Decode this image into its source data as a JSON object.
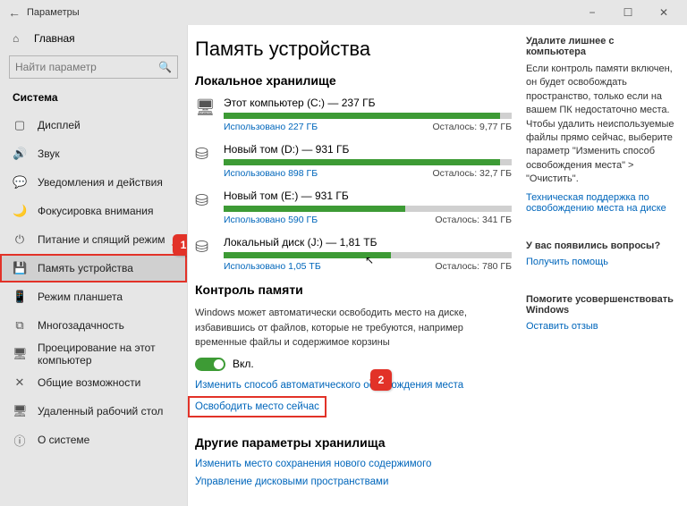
{
  "window": {
    "title": "Параметры"
  },
  "sidebar": {
    "home_label": "Главная",
    "search_placeholder": "Найти параметр",
    "group_label": "Система",
    "items": [
      {
        "icon": "▢",
        "label": "Дисплей"
      },
      {
        "icon": "🔊",
        "label": "Звук"
      },
      {
        "icon": "💬",
        "label": "Уведомления и действия"
      },
      {
        "icon": "🌙",
        "label": "Фокусировка внимания"
      },
      {
        "icon": "⏻",
        "label": "Питание и спящий режим"
      },
      {
        "icon": "💾",
        "label": "Память устройства"
      },
      {
        "icon": "📱",
        "label": "Режим планшета"
      },
      {
        "icon": "⧉",
        "label": "Многозадачность"
      },
      {
        "icon": "🖥",
        "label": "Проецирование на этот компьютер"
      },
      {
        "icon": "✕",
        "label": "Общие возможности"
      },
      {
        "icon": "🖥",
        "label": "Удаленный рабочий стол"
      },
      {
        "icon": "ⓘ",
        "label": "О системе"
      }
    ],
    "selected_index": 5
  },
  "annotations": {
    "badge1": "1",
    "badge2": "2"
  },
  "page": {
    "title": "Память устройства",
    "local_storage_header": "Локальное хранилище",
    "drives": [
      {
        "name": "Этот компьютер (C:) — 237 ГБ",
        "used_label": "Использовано 227 ГБ",
        "free_label": "Осталось: 9,77 ГБ",
        "fill_pct": 96,
        "icon": "pc"
      },
      {
        "name": "Новый том (D:) — 931 ГБ",
        "used_label": "Использовано 898 ГБ",
        "free_label": "Осталось: 32,7 ГБ",
        "fill_pct": 96,
        "icon": "disk"
      },
      {
        "name": "Новый том (E:) — 931 ГБ",
        "used_label": "Использовано 590 ГБ",
        "free_label": "Осталось: 341 ГБ",
        "fill_pct": 63,
        "icon": "disk"
      },
      {
        "name": "Локальный диск (J:) — 1,81 ТБ",
        "used_label": "Использовано 1,05 ТБ",
        "free_label": "Осталось: 780 ГБ",
        "fill_pct": 58,
        "icon": "disk"
      }
    ],
    "sense": {
      "header": "Контроль памяти",
      "desc": "Windows может автоматически освободить место на диске, избавившись от файлов, которые не требуются, например временные файлы и содержимое корзины",
      "toggle_label": "Вкл.",
      "link_change": "Изменить способ автоматического освобождения места",
      "link_free_now": "Освободить место сейчас"
    },
    "other": {
      "header": "Другие параметры хранилища",
      "link_change_save": "Изменить место сохранения нового содержимого",
      "link_spaces": "Управление дисковыми пространствами"
    }
  },
  "right": {
    "b1": {
      "title": "Удалите лишнее с компьютера",
      "text": "Если контроль памяти включен, он будет освобождать пространство, только если на вашем ПК недостаточно места. Чтобы удалить неиспользуемые файлы прямо сейчас, выберите параметр \"Изменить способ освобождения места\" > \"Очистить\".",
      "link": "Техническая поддержка по освобождению места на диске"
    },
    "b2": {
      "title": "У вас появились вопросы?",
      "link": "Получить помощь"
    },
    "b3": {
      "title": "Помогите усовершенствовать Windows",
      "link": "Оставить отзыв"
    }
  }
}
